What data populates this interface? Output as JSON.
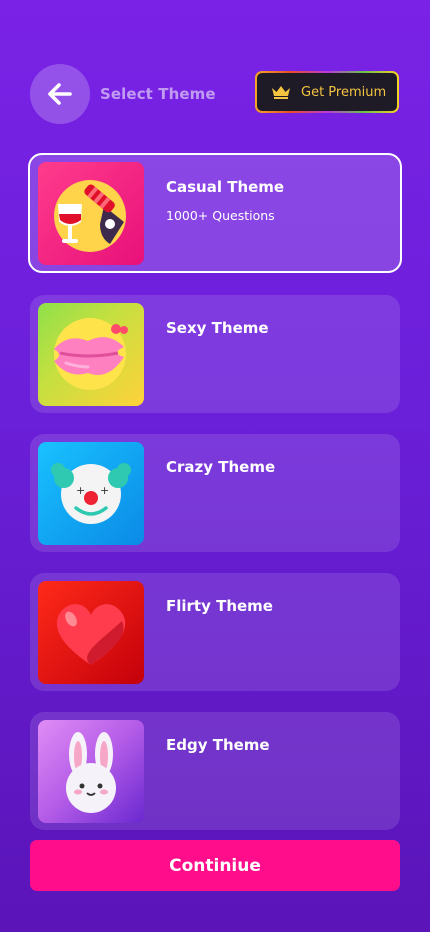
{
  "header": {
    "title": "Select Theme",
    "back_icon": "arrow-left-icon",
    "premium_label": "Get Premium",
    "premium_icon": "crown-icon"
  },
  "themes": [
    {
      "name": "Casual Theme",
      "subtitle": "1000+ Questions",
      "selected": true,
      "icon": "wine-glass-icon"
    },
    {
      "name": "Sexy Theme",
      "subtitle": "",
      "selected": false,
      "icon": "lips-icon"
    },
    {
      "name": "Crazy Theme",
      "subtitle": "",
      "selected": false,
      "icon": "clown-icon"
    },
    {
      "name": "Flirty Theme",
      "subtitle": "",
      "selected": false,
      "icon": "heart-icon"
    },
    {
      "name": "Edgy Theme",
      "subtitle": "",
      "selected": false,
      "icon": "bunny-icon"
    }
  ],
  "continue_label": "Continiue",
  "colors": {
    "accent": "#ff0d8a",
    "premium_text": "#f5c542",
    "background_top": "#7a22e6",
    "background_bottom": "#5a14b8"
  }
}
